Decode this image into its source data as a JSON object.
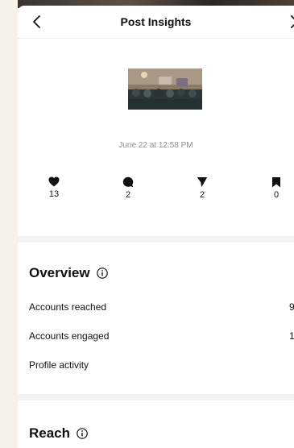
{
  "header": {
    "title": "Post Insights",
    "back_icon": "chevron-left-icon",
    "next_icon": "chevron-right-icon"
  },
  "post": {
    "date": "June 22 at 12:58 PM"
  },
  "stats": [
    {
      "icon": "heart-icon",
      "value": "13"
    },
    {
      "icon": "comment-icon",
      "value": "2"
    },
    {
      "icon": "share-icon",
      "value": "2"
    },
    {
      "icon": "bookmark-icon",
      "value": "0"
    }
  ],
  "overview": {
    "title": "Overview",
    "rows": [
      {
        "label": "Accounts reached",
        "value": "9"
      },
      {
        "label": "Accounts engaged",
        "value": "1"
      },
      {
        "label": "Profile activity",
        "value": ""
      }
    ]
  },
  "reach": {
    "title": "Reach"
  }
}
